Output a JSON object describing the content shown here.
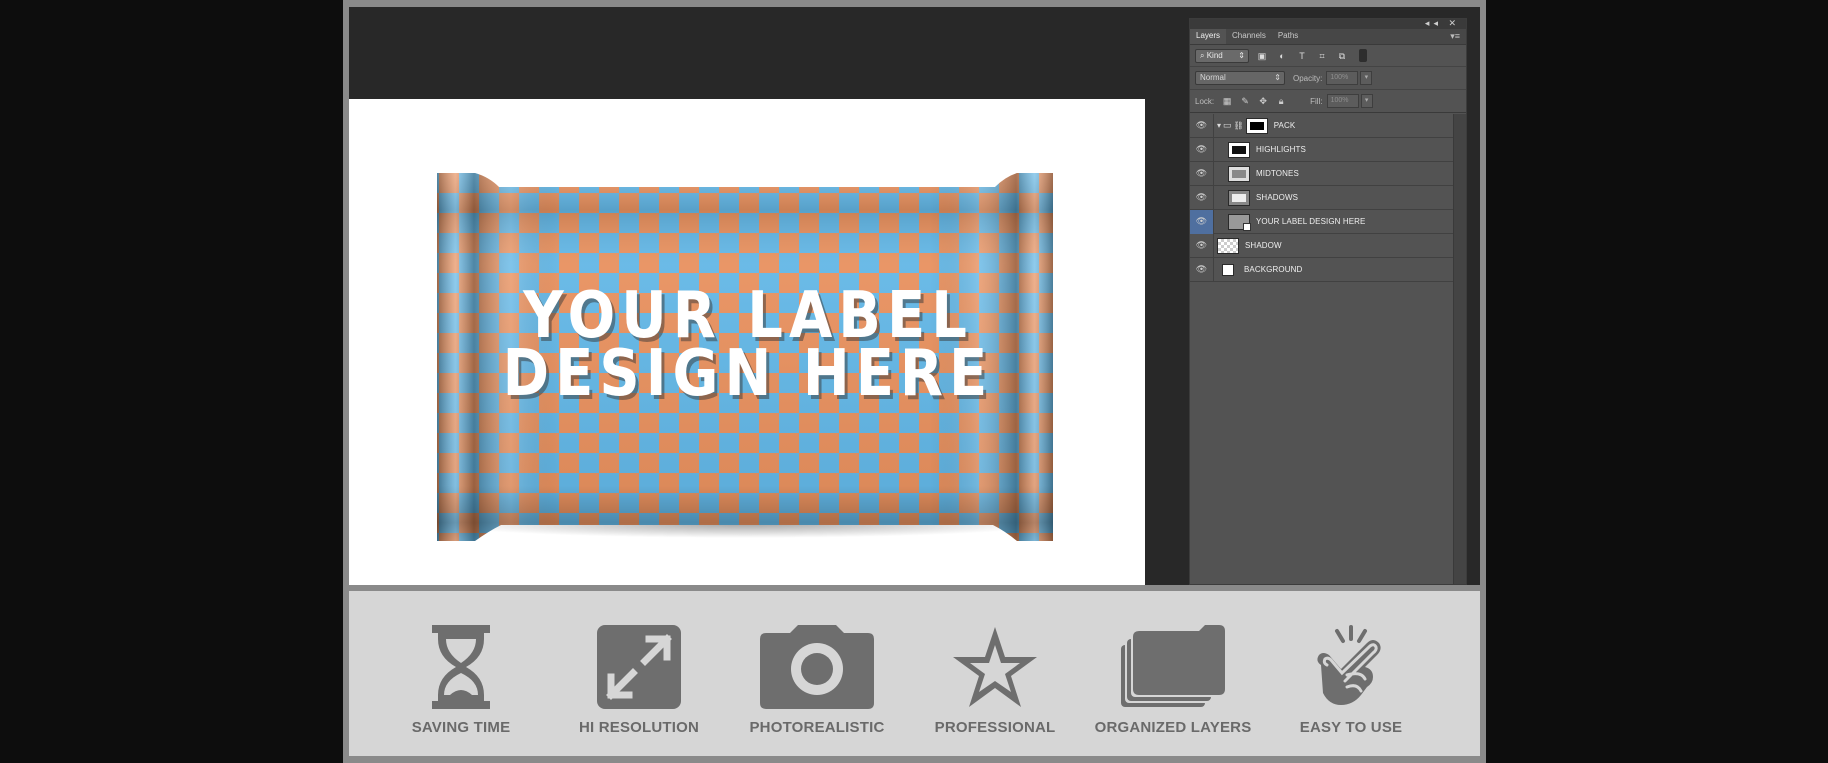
{
  "layers_panel": {
    "tabs": [
      "Layers",
      "Channels",
      "Paths"
    ],
    "filter_kind": "Kind",
    "blend_mode": "Normal",
    "opacity_label": "Opacity:",
    "opacity_value": "100%",
    "lock_label": "Lock:",
    "fill_label": "Fill:",
    "fill_value": "100%",
    "layers": [
      {
        "name": "PACK",
        "type": "group",
        "expanded": true
      },
      {
        "name": "HIGHLIGHTS",
        "type": "layer"
      },
      {
        "name": "MIDTONES",
        "type": "layer"
      },
      {
        "name": "SHADOWS",
        "type": "layer"
      },
      {
        "name": "YOUR LABEL DESIGN HERE",
        "type": "smart-object",
        "selected": true
      },
      {
        "name": "SHADOW",
        "type": "layer"
      },
      {
        "name": "BACKGROUND",
        "type": "layer"
      }
    ]
  },
  "canvas": {
    "label_line1": "YOUR LABEL",
    "label_line2": "DESIGN HERE",
    "pattern_colors": [
      "#e8915f",
      "#63b7e6"
    ]
  },
  "features": [
    {
      "icon": "hourglass-icon",
      "label": "SAVING TIME"
    },
    {
      "icon": "expand-arrows-icon",
      "label": "HI RESOLUTION"
    },
    {
      "icon": "camera-icon",
      "label": "PHOTOREALISTIC"
    },
    {
      "icon": "star-icon",
      "label": "PROFESSIONAL"
    },
    {
      "icon": "folders-icon",
      "label": "ORGANIZED LAYERS"
    },
    {
      "icon": "pointing-hand-icon",
      "label": "EASY TO USE"
    }
  ]
}
